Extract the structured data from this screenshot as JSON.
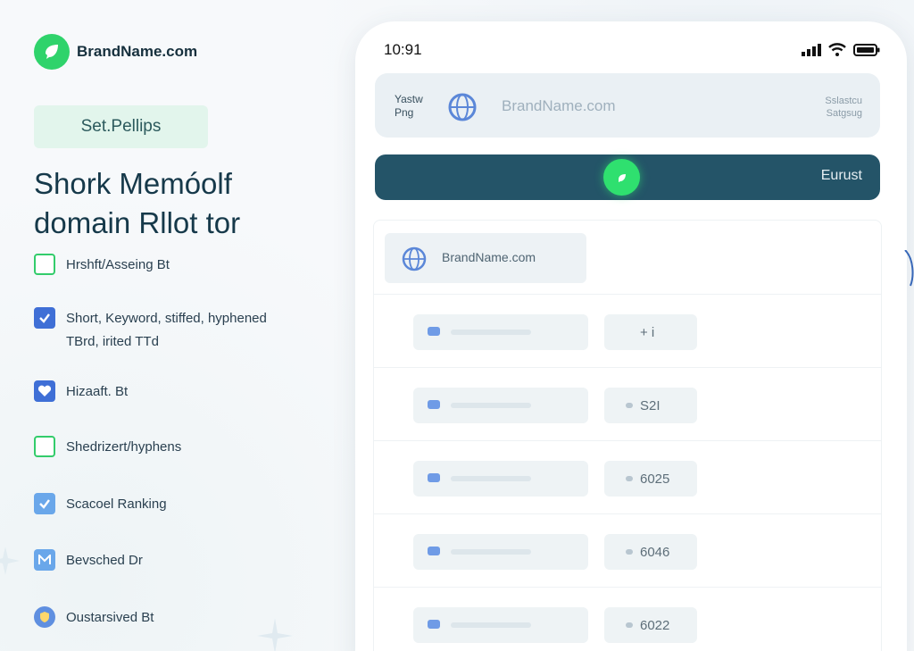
{
  "brand": {
    "name": "BrandName.com",
    "logo_icon": "leaf-icon",
    "accent": "#2fd36b"
  },
  "pill_label": "Set.Pellips",
  "headline": {
    "line1": "Shork Memóolf",
    "line2": "domain Rllot tor"
  },
  "features": [
    {
      "label": "Hrshft/Asseing Bt",
      "icon": "checkbox-empty-icon",
      "style": "outline"
    },
    {
      "label": "Short, Keyword, stiffed, hyphened",
      "label2": "TBrd, irited TTd",
      "icon": "checkbox-checked-icon",
      "style": "filled"
    },
    {
      "label": "Hizaaft. Bt",
      "icon": "heart-icon",
      "style": "filled"
    },
    {
      "label": "Shedrizert/hyphens",
      "icon": "checkbox-empty-icon",
      "style": "outline"
    },
    {
      "label": "Scacoel Ranking",
      "icon": "checkbox-checked-icon",
      "style": "light"
    },
    {
      "label": "Bevsched Dr",
      "icon": "m-badge-icon",
      "style": "light"
    },
    {
      "label": "Oustarsived Bt",
      "icon": "shield-icon",
      "style": "badge"
    }
  ],
  "phone": {
    "time": "10:91",
    "status_icons": [
      "signal-icon",
      "wifi-icon",
      "battery-icon"
    ],
    "search": {
      "left_line1": "Yastw",
      "left_line2": "Png",
      "brand": "BrandName.com",
      "right_line1": "Sslastcu",
      "right_line2": "Satgsug"
    },
    "action": {
      "label": "Eurust",
      "accent": "#2fe06f",
      "bar_color": "#245468"
    },
    "results_header": "BrandName.com",
    "rows": [
      {
        "value": "+ i"
      },
      {
        "value": "S2I"
      },
      {
        "value": "6025"
      },
      {
        "value": "6046"
      },
      {
        "value": "6022"
      }
    ]
  }
}
